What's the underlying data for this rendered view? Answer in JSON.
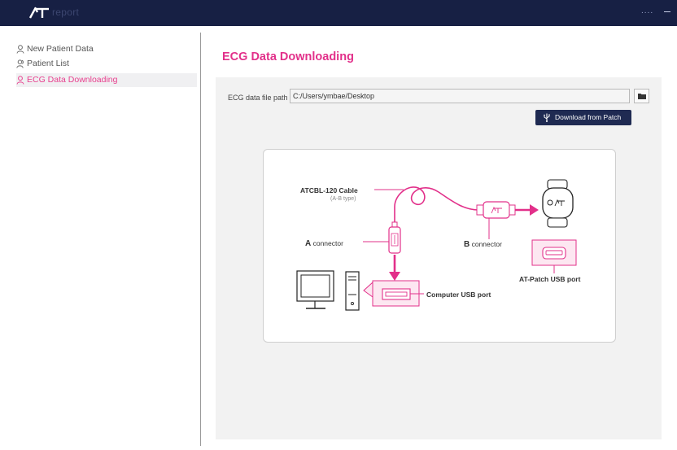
{
  "app": {
    "logo_text": "report",
    "menu_dots": "...."
  },
  "sidebar": {
    "items": [
      {
        "label": "New Patient Data",
        "icon": "person-icon",
        "active": false
      },
      {
        "label": "Patient List",
        "icon": "people-icon",
        "active": false
      },
      {
        "label": "ECG Data Downloading",
        "icon": "person-icon",
        "active": true
      }
    ]
  },
  "main": {
    "title": "ECG Data Downloading",
    "path_label": "ECG data file path :",
    "path_value": "C:/Users/ymbae/Desktop",
    "download_button": "Download from Patch"
  },
  "diagram": {
    "cable_label": "ATCBL-120 Cable",
    "cable_type": "(A-B type)",
    "a_letter": "A",
    "a_rest": " connector",
    "b_letter": "B",
    "b_rest": " connector",
    "computer_port": "Computer USB port",
    "patch_port": "AT-Patch USB port"
  },
  "colors": {
    "accent": "#e2308a",
    "titlebar": "#172044",
    "button": "#1f2a52"
  }
}
